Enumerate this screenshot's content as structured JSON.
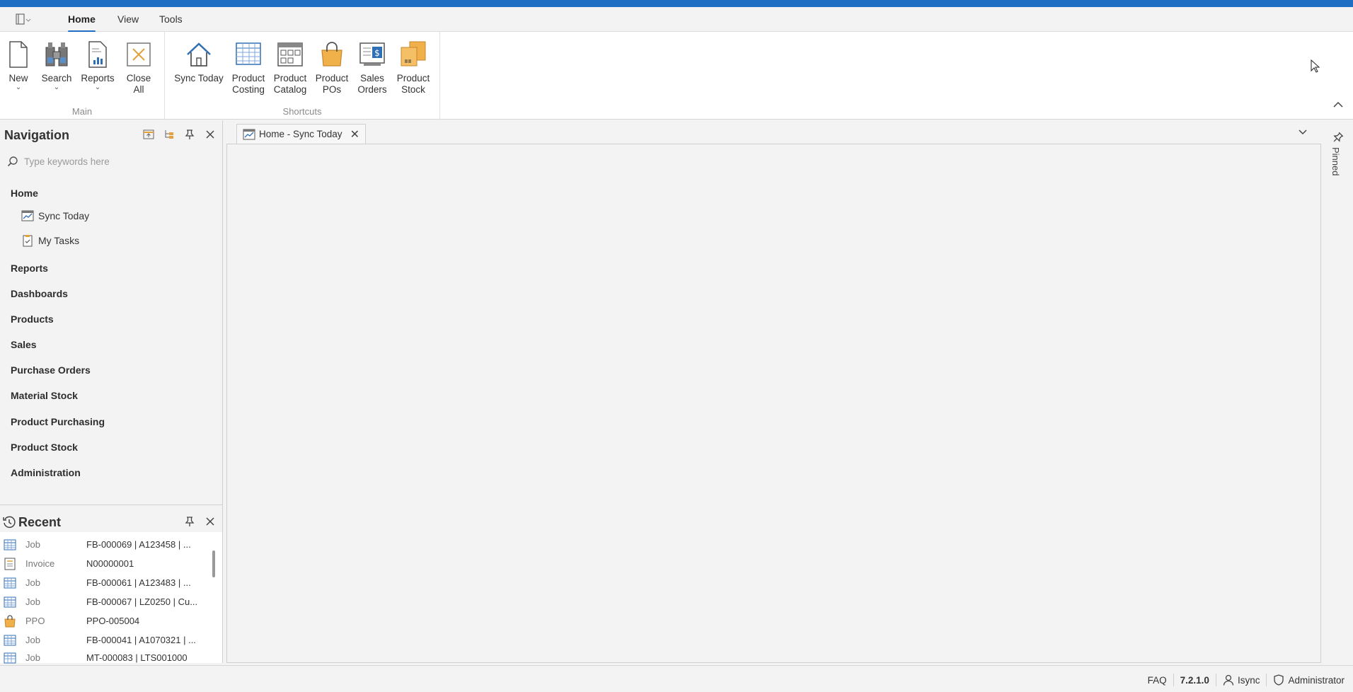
{
  "ribbon_tabs": [
    {
      "label": "Home",
      "active": true
    },
    {
      "label": "View",
      "active": false
    },
    {
      "label": "Tools",
      "active": false
    }
  ],
  "ribbon": {
    "main_group": {
      "label": "Main",
      "buttons": [
        {
          "label": "New",
          "icon": "new-document-icon",
          "has_dropdown": true
        },
        {
          "label": "Search",
          "icon": "binoculars-icon",
          "has_dropdown": true
        },
        {
          "label": "Reports",
          "icon": "report-icon",
          "has_dropdown": true
        },
        {
          "label": "Close All",
          "icon": "close-all-icon",
          "has_dropdown": false
        }
      ]
    },
    "shortcuts_group": {
      "label": "Shortcuts",
      "buttons": [
        {
          "label": "Sync Today",
          "icon": "home-icon"
        },
        {
          "label": "Product Costing",
          "icon": "spreadsheet-icon"
        },
        {
          "label": "Product Catalog",
          "icon": "catalog-icon"
        },
        {
          "label": "Product POs",
          "icon": "shopping-bag-icon"
        },
        {
          "label": "Sales Orders",
          "icon": "sales-order-icon"
        },
        {
          "label": "Product Stock",
          "icon": "boxes-icon"
        }
      ]
    }
  },
  "navigation": {
    "title": "Navigation",
    "search_placeholder": "Type keywords here",
    "groups": [
      {
        "label": "Home",
        "items": [
          {
            "label": "Sync Today",
            "icon": "chart-icon"
          },
          {
            "label": "My Tasks",
            "icon": "clipboard-icon"
          }
        ]
      },
      {
        "label": "Reports"
      },
      {
        "label": "Dashboards"
      },
      {
        "label": "Products"
      },
      {
        "label": "Sales"
      },
      {
        "label": "Purchase Orders"
      },
      {
        "label": "Material Stock"
      },
      {
        "label": "Product Purchasing"
      },
      {
        "label": "Product Stock"
      },
      {
        "label": "Administration"
      }
    ]
  },
  "recent": {
    "title": "Recent",
    "rows": [
      {
        "type": "Job",
        "value": "FB-000069 | A123458 | ...",
        "icon": "job-grid-icon"
      },
      {
        "type": "Invoice",
        "value": "N00000001",
        "icon": "invoice-icon"
      },
      {
        "type": "Job",
        "value": "FB-000061 | A123483 | ...",
        "icon": "job-grid-icon"
      },
      {
        "type": "Job",
        "value": "FB-000067 | LZ0250 | Cu...",
        "icon": "job-grid-icon"
      },
      {
        "type": "PPO",
        "value": "PPO-005004",
        "icon": "shopping-bag-icon"
      },
      {
        "type": "Job",
        "value": "FB-000041 | A1070321 | ...",
        "icon": "job-grid-icon"
      },
      {
        "type": "Job",
        "value": "MT-000083 | LTS001000",
        "icon": "job-grid-icon"
      }
    ]
  },
  "document": {
    "tab_label": "Home - Sync Today"
  },
  "pinned_label": "Pinned",
  "status_bar": {
    "faq": "FAQ",
    "version": "7.2.1.0",
    "user": "Isync",
    "role": "Administrator"
  },
  "colors": {
    "accent": "#1e6fc4",
    "icon_blue": "#2f6fb5",
    "icon_orange": "#e3a23b"
  }
}
